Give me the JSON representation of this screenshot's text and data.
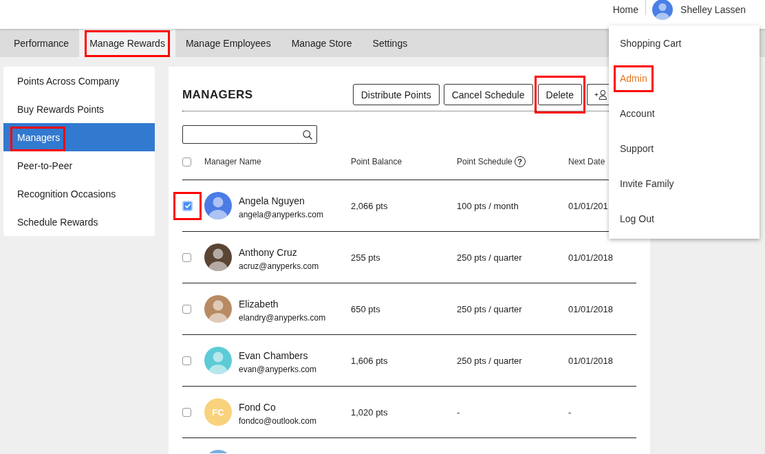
{
  "header": {
    "home_link": "Home",
    "user": {
      "name": "Shelley Lassen",
      "avatar": {
        "kind": "photo",
        "color": "#4a7fe6"
      }
    }
  },
  "tabs": [
    {
      "label": "Performance",
      "selected": false,
      "highlighted": false
    },
    {
      "label": "Manage Rewards",
      "selected": true,
      "highlighted": true
    },
    {
      "label": "Manage Employees",
      "selected": false,
      "highlighted": false
    },
    {
      "label": "Manage Store",
      "selected": false,
      "highlighted": false
    },
    {
      "label": "Settings",
      "selected": false,
      "highlighted": false
    }
  ],
  "sidebar": {
    "items": [
      {
        "label": "Points Across Company",
        "selected": false,
        "highlighted": false
      },
      {
        "label": "Buy Rewards Points",
        "selected": false,
        "highlighted": false
      },
      {
        "label": "Managers",
        "selected": true,
        "highlighted": true
      },
      {
        "label": "Peer-to-Peer",
        "selected": false,
        "highlighted": false
      },
      {
        "label": "Recognition Occasions",
        "selected": false,
        "highlighted": false
      },
      {
        "label": "Schedule Rewards",
        "selected": false,
        "highlighted": false
      }
    ]
  },
  "panel": {
    "title": "MANAGERS",
    "buttons": [
      {
        "kind": "text",
        "label": "Distribute Points",
        "highlighted": false
      },
      {
        "kind": "text",
        "label": "Cancel Schedule",
        "highlighted": false
      },
      {
        "kind": "text",
        "label": "Delete",
        "highlighted": true
      },
      {
        "kind": "add-user",
        "highlighted": false
      }
    ],
    "table": {
      "select_all": {
        "checked": false
      },
      "columns": [
        {
          "label": "Manager Name"
        },
        {
          "label": "Point Balance"
        },
        {
          "label": "Point Schedule",
          "help_icon": "?"
        },
        {
          "label": "Next Date"
        }
      ],
      "rows": [
        {
          "kind": "full",
          "checked": true,
          "highlighted": true,
          "avatar": {
            "kind": "photo",
            "color": "#4b7be5"
          },
          "name": "Angela Nguyen",
          "email": "angela@anyperks.com",
          "balance": "2,066 pts",
          "schedule": "100 pts / month",
          "next_date": "01/01/201"
        },
        {
          "kind": "full",
          "checked": false,
          "highlighted": false,
          "avatar": {
            "kind": "photo",
            "color": "#5a4434"
          },
          "name": "Anthony Cruz",
          "email": "acruz@anyperks.com",
          "balance": "255 pts",
          "schedule": "250 pts / quarter",
          "next_date": "01/01/2018"
        },
        {
          "kind": "full",
          "checked": false,
          "highlighted": false,
          "avatar": {
            "kind": "photo",
            "color": "#b88a62"
          },
          "name": "Elizabeth",
          "email": "elandry@anyperks.com",
          "balance": "650 pts",
          "schedule": "250 pts / quarter",
          "next_date": "01/01/2018"
        },
        {
          "kind": "full",
          "checked": false,
          "highlighted": false,
          "avatar": {
            "kind": "photo",
            "color": "#5ccbd6"
          },
          "name": "Evan Chambers",
          "email": "evan@anyperks.com",
          "balance": "1,606 pts",
          "schedule": "250 pts / quarter",
          "next_date": "01/01/2018"
        },
        {
          "kind": "full",
          "checked": false,
          "highlighted": false,
          "avatar": {
            "kind": "initials",
            "initials": "FC",
            "color": "#f8d27c"
          },
          "name": "Fond Co",
          "email": "fondco@outlook.com",
          "balance": "1,020 pts",
          "schedule": "-",
          "next_date": "-"
        },
        {
          "kind": "cut",
          "avatar": {
            "kind": "photo",
            "color": "#78aee0"
          }
        }
      ]
    }
  },
  "user_menu": {
    "items": [
      {
        "label": "Shopping Cart",
        "selected": false,
        "highlighted": false
      },
      {
        "label": "Admin",
        "selected": true,
        "highlighted": true
      },
      {
        "label": "Account",
        "selected": false,
        "highlighted": false
      },
      {
        "label": "Support",
        "selected": false,
        "highlighted": false
      },
      {
        "label": "Invite Family",
        "selected": false,
        "highlighted": false
      },
      {
        "label": "Log Out",
        "selected": false,
        "highlighted": false
      }
    ]
  }
}
